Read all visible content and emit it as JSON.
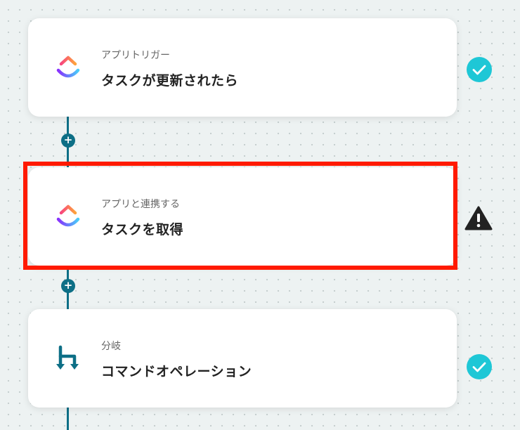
{
  "steps": [
    {
      "subtitle": "アプリトリガー",
      "title": "タスクが更新されたら",
      "icon": "clickup-logo-icon",
      "status": "check-circle-icon"
    },
    {
      "subtitle": "アプリと連携する",
      "title": "タスクを取得",
      "icon": "clickup-logo-icon",
      "status": "warning-icon"
    },
    {
      "subtitle": "分岐",
      "title": "コマンドオペレーション",
      "icon": "branch-icon",
      "status": "check-circle-icon"
    }
  ],
  "add_step_symbol": "+",
  "colors": {
    "connector": "#0d6f86",
    "check": "#1ec7d6",
    "warning": "#222222",
    "highlight": "#ff1a00",
    "branch_icon": "#0d6f86"
  }
}
